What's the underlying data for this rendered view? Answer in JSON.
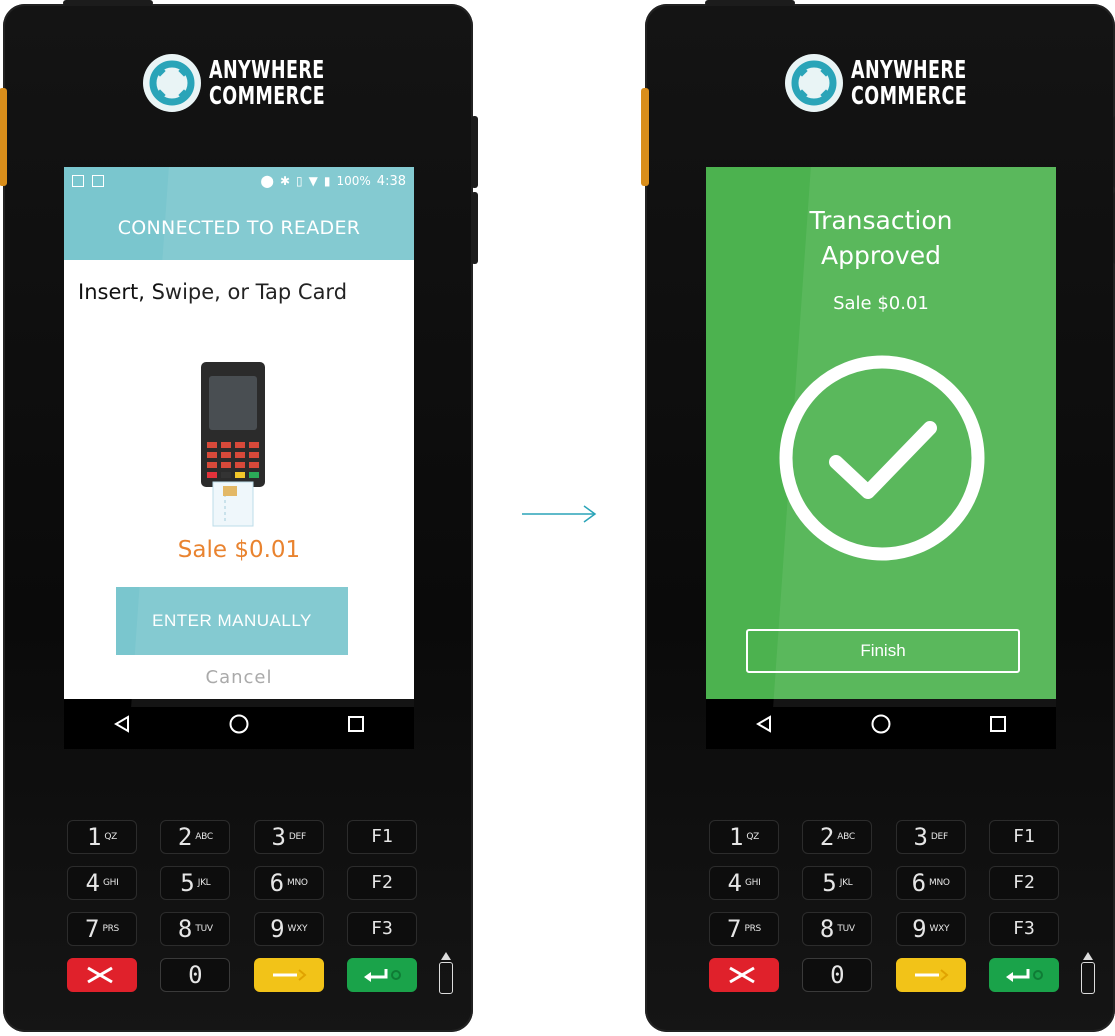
{
  "brand": {
    "line1": "ANYWHERE",
    "line2": "COMMERCE"
  },
  "left_screen": {
    "status": {
      "battery": "100%",
      "time": "4:38"
    },
    "header": "CONNECTED TO READER",
    "prompt": "Insert, Swipe, or Tap Card",
    "sale": "Sale $0.01",
    "enter_button": "ENTER MANUALLY",
    "cancel": "Cancel",
    "accent_color": "#7ac6ce",
    "sale_color": "#e8791e"
  },
  "right_screen": {
    "title_line1": "Transaction",
    "title_line2": "Approved",
    "sale": "Sale $0.01",
    "finish_button": "Finish",
    "background_color": "#4cb24f"
  },
  "keypad": [
    [
      {
        "d": "1",
        "l": "QZ"
      },
      {
        "d": "2",
        "l": "ABC"
      },
      {
        "d": "3",
        "l": "DEF"
      },
      {
        "d": "F1",
        "l": ""
      }
    ],
    [
      {
        "d": "4",
        "l": "GHI"
      },
      {
        "d": "5",
        "l": "JKL"
      },
      {
        "d": "6",
        "l": "MNO"
      },
      {
        "d": "F2",
        "l": ""
      }
    ],
    [
      {
        "d": "7",
        "l": "PRS"
      },
      {
        "d": "8",
        "l": "TUV"
      },
      {
        "d": "9",
        "l": "WXY"
      },
      {
        "d": "F3",
        "l": ""
      }
    ]
  ],
  "zero_key": "0",
  "nav_icons": [
    "back-icon",
    "home-icon",
    "recents-icon"
  ]
}
